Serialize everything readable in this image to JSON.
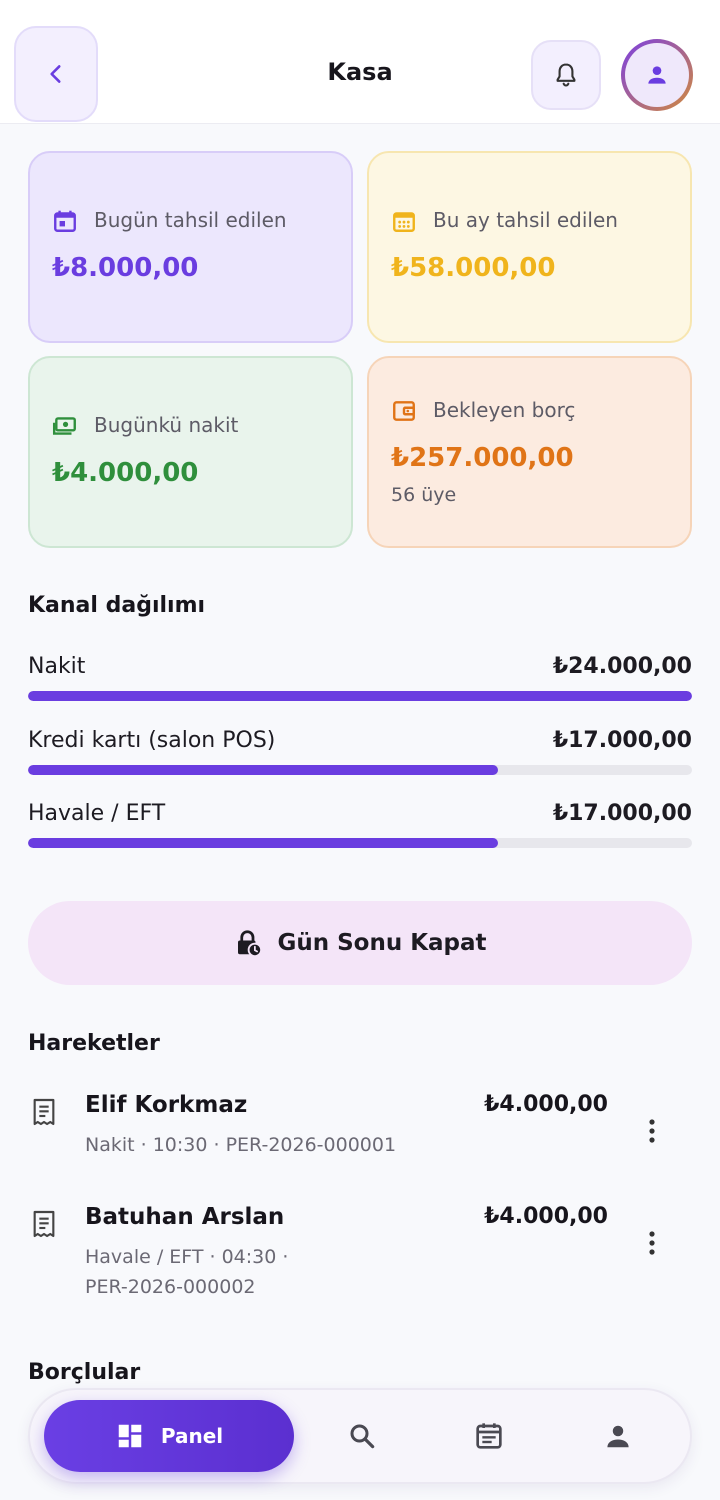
{
  "header": {
    "title": "Kasa",
    "back_icon": "chevron-left-icon",
    "bell_icon": "bell-icon",
    "avatar_icon": "person-icon"
  },
  "stats": [
    {
      "label": "Bugün tahsil edilen",
      "value": "₺8.000,00",
      "icon": "calendar-today-icon",
      "color": "#6a3de0"
    },
    {
      "label": "Bu ay tahsil edilen",
      "value": "₺58.000,00",
      "icon": "calendar-month-icon",
      "color": "#f0b41c"
    },
    {
      "label": "Bugünkü nakit",
      "value": "₺4.000,00",
      "icon": "cash-icon",
      "color": "#2f8f3c"
    },
    {
      "label": "Bekleyen borç",
      "value": "₺257.000,00",
      "sub": "56 üye",
      "icon": "wallet-icon",
      "color": "#e07417"
    }
  ],
  "channels": {
    "title": "Kanal dağılımı",
    "items": [
      {
        "label": "Nakit",
        "amount": "₺24.000,00",
        "share": 1.0
      },
      {
        "label": "Kredi kartı (salon POS)",
        "amount": "₺17.000,00",
        "share": 0.708
      },
      {
        "label": "Havale / EFT",
        "amount": "₺17.000,00",
        "share": 0.708
      }
    ]
  },
  "close_day": {
    "label": "Gün Sonu Kapat",
    "icon": "lock-clock-icon"
  },
  "transactions": {
    "title": "Hareketler",
    "items": [
      {
        "name": "Elif Korkmaz",
        "amount": "₺4.000,00",
        "meta": "Nakit · 10:30 · PER-2026-000001"
      },
      {
        "name": "Batuhan Arslan",
        "amount": "₺4.000,00",
        "meta": "Havale / EFT · 04:30 · PER-2026-000002"
      }
    ]
  },
  "debtors": {
    "title": "Borçlular"
  },
  "nav": {
    "active_label": "Panel",
    "items": [
      "dashboard-icon",
      "search-icon",
      "calendar-icon",
      "person-icon"
    ]
  }
}
